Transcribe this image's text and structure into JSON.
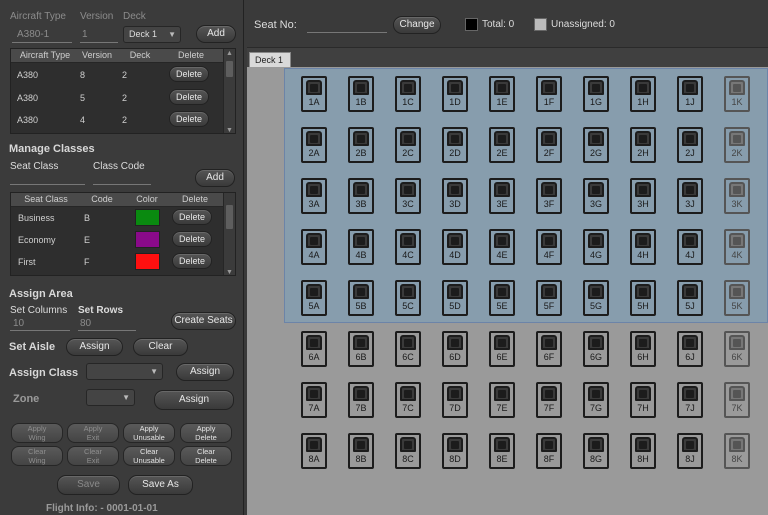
{
  "aircraft_form": {
    "headers": [
      "Aircraft Type",
      "Version",
      "Deck"
    ],
    "type_value": "A380-1",
    "version_value": "1",
    "deck_value": "Deck 1",
    "add_label": "Add"
  },
  "aircraft_table": {
    "headers": [
      "Aircraft Type",
      "Version",
      "Deck",
      "Delete"
    ],
    "rows": [
      {
        "type": "A380",
        "version": "8",
        "deck": "2",
        "action": "Delete"
      },
      {
        "type": "A380",
        "version": "5",
        "deck": "2",
        "action": "Delete"
      },
      {
        "type": "A380",
        "version": "4",
        "deck": "2",
        "action": "Delete"
      }
    ]
  },
  "classes": {
    "title": "Manage Classes",
    "seat_class_label": "Seat Class",
    "class_code_label": "Class Code",
    "add_label": "Add",
    "headers": [
      "Seat Class",
      "Code",
      "Color",
      "Delete"
    ],
    "rows": [
      {
        "name": "Business",
        "code": "B",
        "color": "#0a8a10",
        "action": "Delete"
      },
      {
        "name": "Economy",
        "code": "E",
        "color": "#8a0a8a",
        "action": "Delete"
      },
      {
        "name": "First",
        "code": "F",
        "color": "#ff1010",
        "action": "Delete"
      }
    ]
  },
  "assign_area": {
    "title": "Assign Area",
    "columns_label": "Set Columns",
    "rows_label": "Set Rows",
    "columns_value": "10",
    "rows_value": "80",
    "create_label": "Create Seats"
  },
  "aisle": {
    "label": "Set Aisle",
    "assign": "Assign",
    "clear": "Clear"
  },
  "assign_class": {
    "label": "Assign Class",
    "button": "Assign"
  },
  "zone": {
    "label": "Zone",
    "button": "Assign"
  },
  "apply_buttons": [
    [
      "Apply",
      "Wing"
    ],
    [
      "Apply",
      "Exit"
    ],
    [
      "Apply",
      "Unusable"
    ],
    [
      "Apply",
      "Delete"
    ],
    [
      "Clear",
      "Wing"
    ],
    [
      "Clear",
      "Exit"
    ],
    [
      "Clear",
      "Unusable"
    ],
    [
      "Clear",
      "Delete"
    ]
  ],
  "bottom": {
    "save": "Save",
    "save_as": "Save As",
    "flight_info": "Flight Info:  -  0001-01-01"
  },
  "seatbar": {
    "seat_no_label": "Seat No:",
    "change_label": "Change",
    "total_label": "Total: 0",
    "unassigned_label": "Unassigned: 0",
    "total_color": "#000000",
    "unassigned_color": "#bbbbbb"
  },
  "tab_label": "Deck 1",
  "seats": {
    "rows": [
      "1",
      "2",
      "3",
      "4",
      "5",
      "6",
      "7",
      "8"
    ],
    "columns": [
      "A",
      "B",
      "C",
      "D",
      "E",
      "F",
      "G",
      "H",
      "J",
      "K"
    ],
    "selected_rows": [
      "1",
      "2",
      "3",
      "4",
      "5"
    ]
  }
}
